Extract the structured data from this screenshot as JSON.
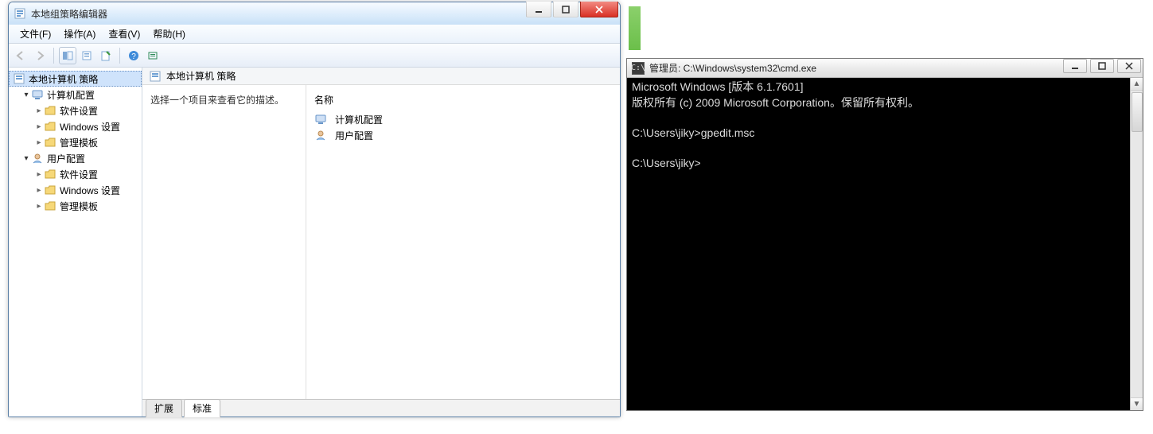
{
  "gpe": {
    "windowTitle": "本地组策略编辑器",
    "menu": {
      "file": "文件(F)",
      "action": "操作(A)",
      "view": "查看(V)",
      "help": "帮助(H)"
    },
    "tree": {
      "root": "本地计算机 策略",
      "computer": "计算机配置",
      "softwareSettings": "软件设置",
      "windowsSettings": "Windows 设置",
      "adminTemplates": "管理模板",
      "user": "用户配置"
    },
    "right": {
      "headerTitle": "本地计算机 策略",
      "descHint": "选择一个项目来查看它的描述。",
      "colName": "名称",
      "items": {
        "computer": "计算机配置",
        "user": "用户配置"
      },
      "tabs": {
        "extended": "扩展",
        "standard": "标准"
      }
    }
  },
  "cmd": {
    "windowTitle": "管理员: C:\\Windows\\system32\\cmd.exe",
    "line1": "Microsoft Windows [版本 6.1.7601]",
    "line2": "版权所有 (c) 2009 Microsoft Corporation。保留所有权利。",
    "line3": "C:\\Users\\jiky>gpedit.msc",
    "line4": "C:\\Users\\jiky>"
  }
}
